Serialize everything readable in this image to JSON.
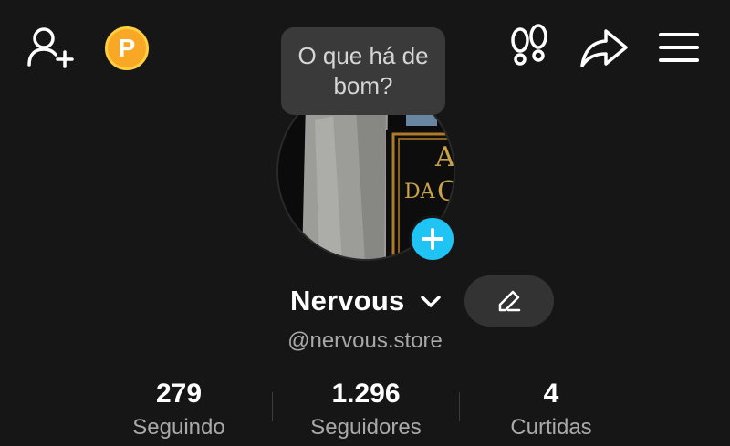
{
  "header": {
    "icons": {
      "add_friend": "person-add-icon",
      "coin": "coin-icon",
      "footprints": "footprints-icon",
      "share": "share-icon",
      "menu": "hamburger-menu-icon"
    },
    "coin_letter": "P"
  },
  "tooltip": {
    "text": "O que há de bom?"
  },
  "profile": {
    "display_name": "Nervous",
    "handle": "@nervous.store",
    "edit_icon": "pencil-icon",
    "add_story_icon": "plus-icon"
  },
  "stats": [
    {
      "value": "279",
      "label": "Seguindo"
    },
    {
      "value": "1.296",
      "label": "Seguidores"
    },
    {
      "value": "4",
      "label": "Curtidas"
    }
  ],
  "colors": {
    "background": "#161616",
    "accent": "#20c4f4",
    "coin": "#f9a825",
    "muted_text": "#a9a9a9",
    "button_bg": "#333333"
  }
}
